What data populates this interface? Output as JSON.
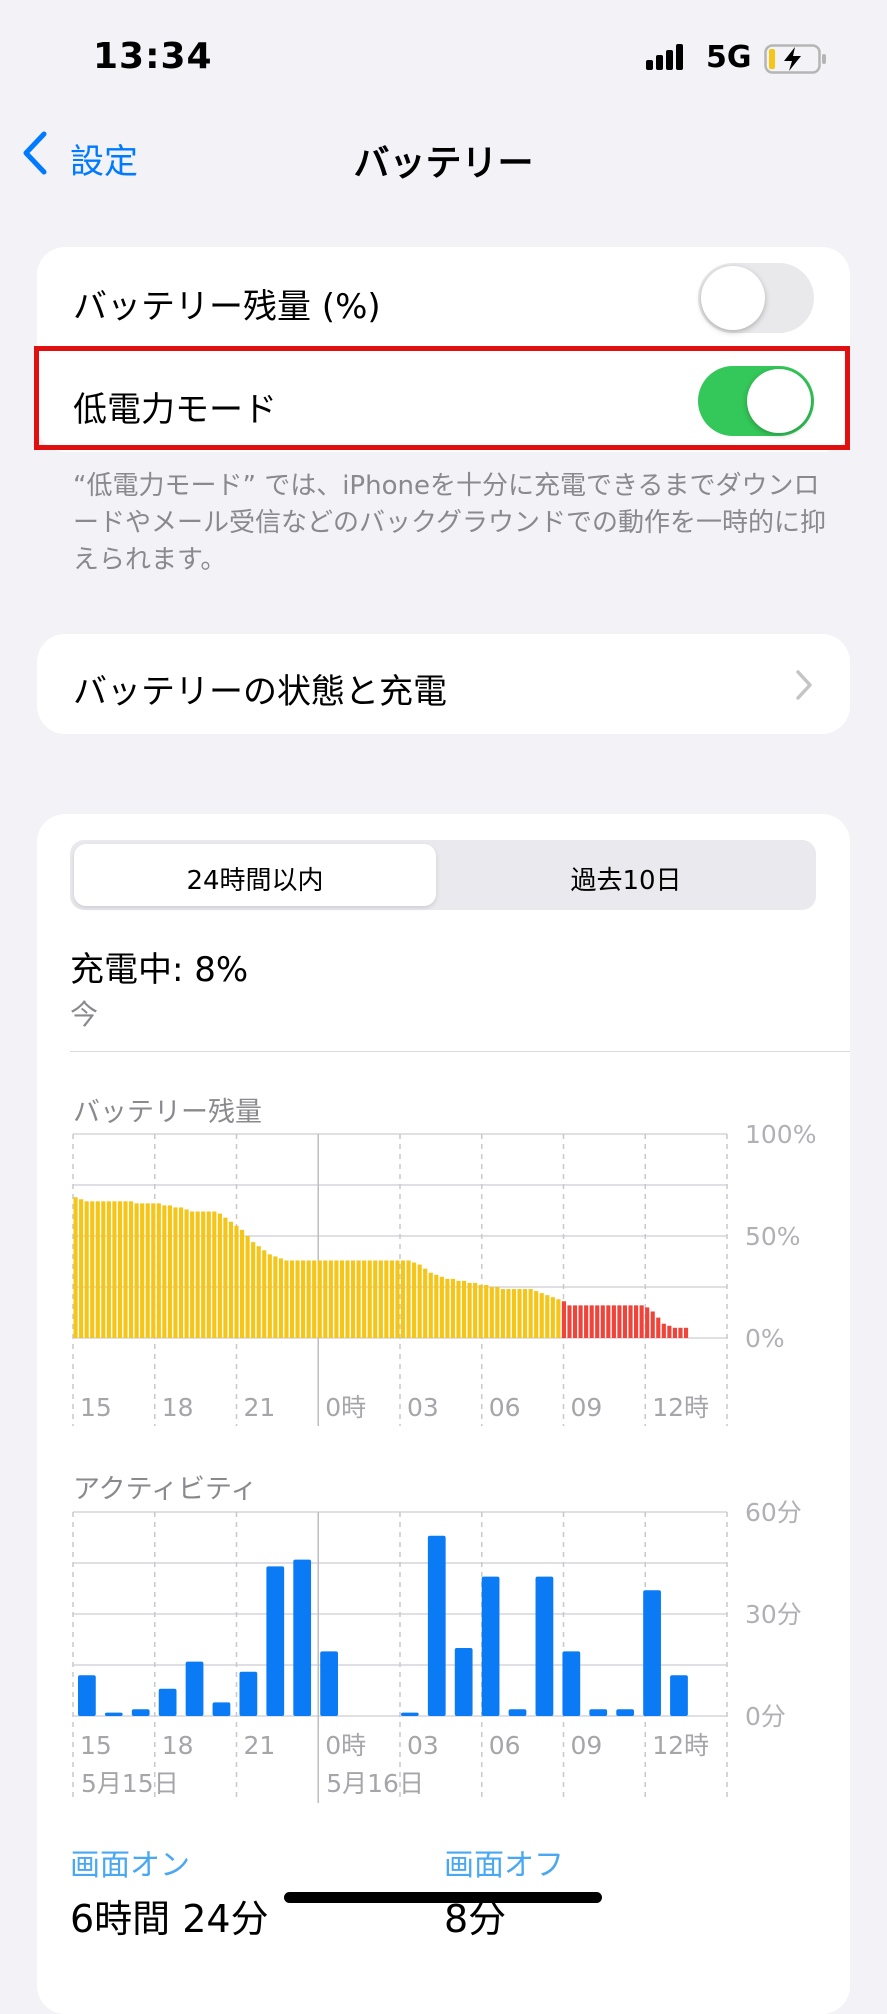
{
  "status_bar": {
    "time": "13:34",
    "network": "5G"
  },
  "nav": {
    "back_label": "設定",
    "title": "バッテリー"
  },
  "settings": {
    "battery_percentage": {
      "label": "バッテリー残量 (%)",
      "on": false
    },
    "low_power_mode": {
      "label": "低電力モード",
      "on": true
    },
    "footnote": "“低電力モード” では、iPhoneを十分に充電できるまでダウンロードやメール受信などのバックグラウンドでの動作を一時的に抑えられます。",
    "battery_health": {
      "label": "バッテリーの状態と充電"
    }
  },
  "usage": {
    "tabs": [
      "24時間以内",
      "過去10日"
    ],
    "selected_tab": 0,
    "charging_text": "充電中: 8%",
    "charging_time": "今",
    "battery_chart_title": "バッテリー残量",
    "activity_chart_title": "アクティビティ",
    "x_ticks": [
      "15",
      "18",
      "21",
      "0時",
      "03",
      "06",
      "09",
      "12時"
    ],
    "day_labels": [
      "5月15日",
      "5月16日"
    ],
    "screen_on_label": "画面オン",
    "screen_off_label": "画面オフ",
    "screen_on_value": "6時間 24分",
    "screen_off_value": "8分"
  },
  "colors": {
    "accent": "#007aff",
    "toggle_on": "#34c759",
    "toggle_off": "#e9e9eb",
    "battery_bar": "#f5c518",
    "battery_low": "#f0443a",
    "activity_bar": "#0a7af5",
    "highlight": "#e01010"
  },
  "icons": {
    "signal": "cellular-signal-icon",
    "battery": "battery-charging-icon",
    "back": "chevron-left-icon",
    "disclosure": "chevron-right-icon"
  },
  "chart_data": [
    {
      "type": "bar",
      "title": "バッテリー残量",
      "ylim": [
        0,
        100
      ],
      "y_ticks": [
        "100%",
        "50%",
        "0%"
      ],
      "x_ticks": [
        "15",
        "18",
        "21",
        "0時",
        "03",
        "06",
        "09",
        "12時"
      ],
      "values": [
        69,
        68,
        67,
        67,
        67,
        67,
        67,
        67,
        67,
        67,
        67,
        66,
        66,
        66,
        66,
        66,
        65,
        65,
        64,
        64,
        63,
        62,
        62,
        62,
        62,
        62,
        61,
        59,
        57,
        55,
        53,
        50,
        47,
        45,
        43,
        41,
        40,
        39,
        38,
        38,
        38,
        38,
        38,
        38,
        38,
        38,
        38,
        38,
        38,
        38,
        38,
        38,
        38,
        38,
        38,
        38,
        38,
        38,
        38,
        38,
        38,
        37,
        36,
        34,
        32,
        31,
        30,
        29,
        29,
        28,
        28,
        27,
        27,
        26,
        26,
        25,
        25,
        24,
        24,
        24,
        24,
        24,
        24,
        23,
        22,
        21,
        20,
        19,
        18,
        16,
        16,
        16,
        16,
        16,
        16,
        16,
        16,
        16,
        16,
        16,
        16,
        16,
        16,
        15,
        13,
        10,
        7,
        6,
        5,
        5,
        5
      ],
      "low_threshold_index": 88,
      "grid": true
    },
    {
      "type": "bar",
      "title": "アクティビティ",
      "ylim": [
        0,
        60
      ],
      "y_ticks": [
        "60分",
        "30分",
        "0分"
      ],
      "x_ticks": [
        "15",
        "18",
        "21",
        "0時",
        "03",
        "06",
        "09",
        "12時"
      ],
      "categories": [
        "14",
        "15",
        "16",
        "17",
        "18",
        "19",
        "20",
        "21",
        "22",
        "23",
        "0",
        "1",
        "2",
        "3",
        "4",
        "5",
        "6",
        "7",
        "8",
        "9",
        "10",
        "11",
        "12",
        "13"
      ],
      "values": [
        12,
        1,
        2,
        8,
        16,
        4,
        13,
        44,
        46,
        19,
        0,
        0,
        1,
        53,
        20,
        41,
        2,
        41,
        19,
        2,
        2,
        37,
        12,
        0
      ],
      "grid": true
    }
  ]
}
